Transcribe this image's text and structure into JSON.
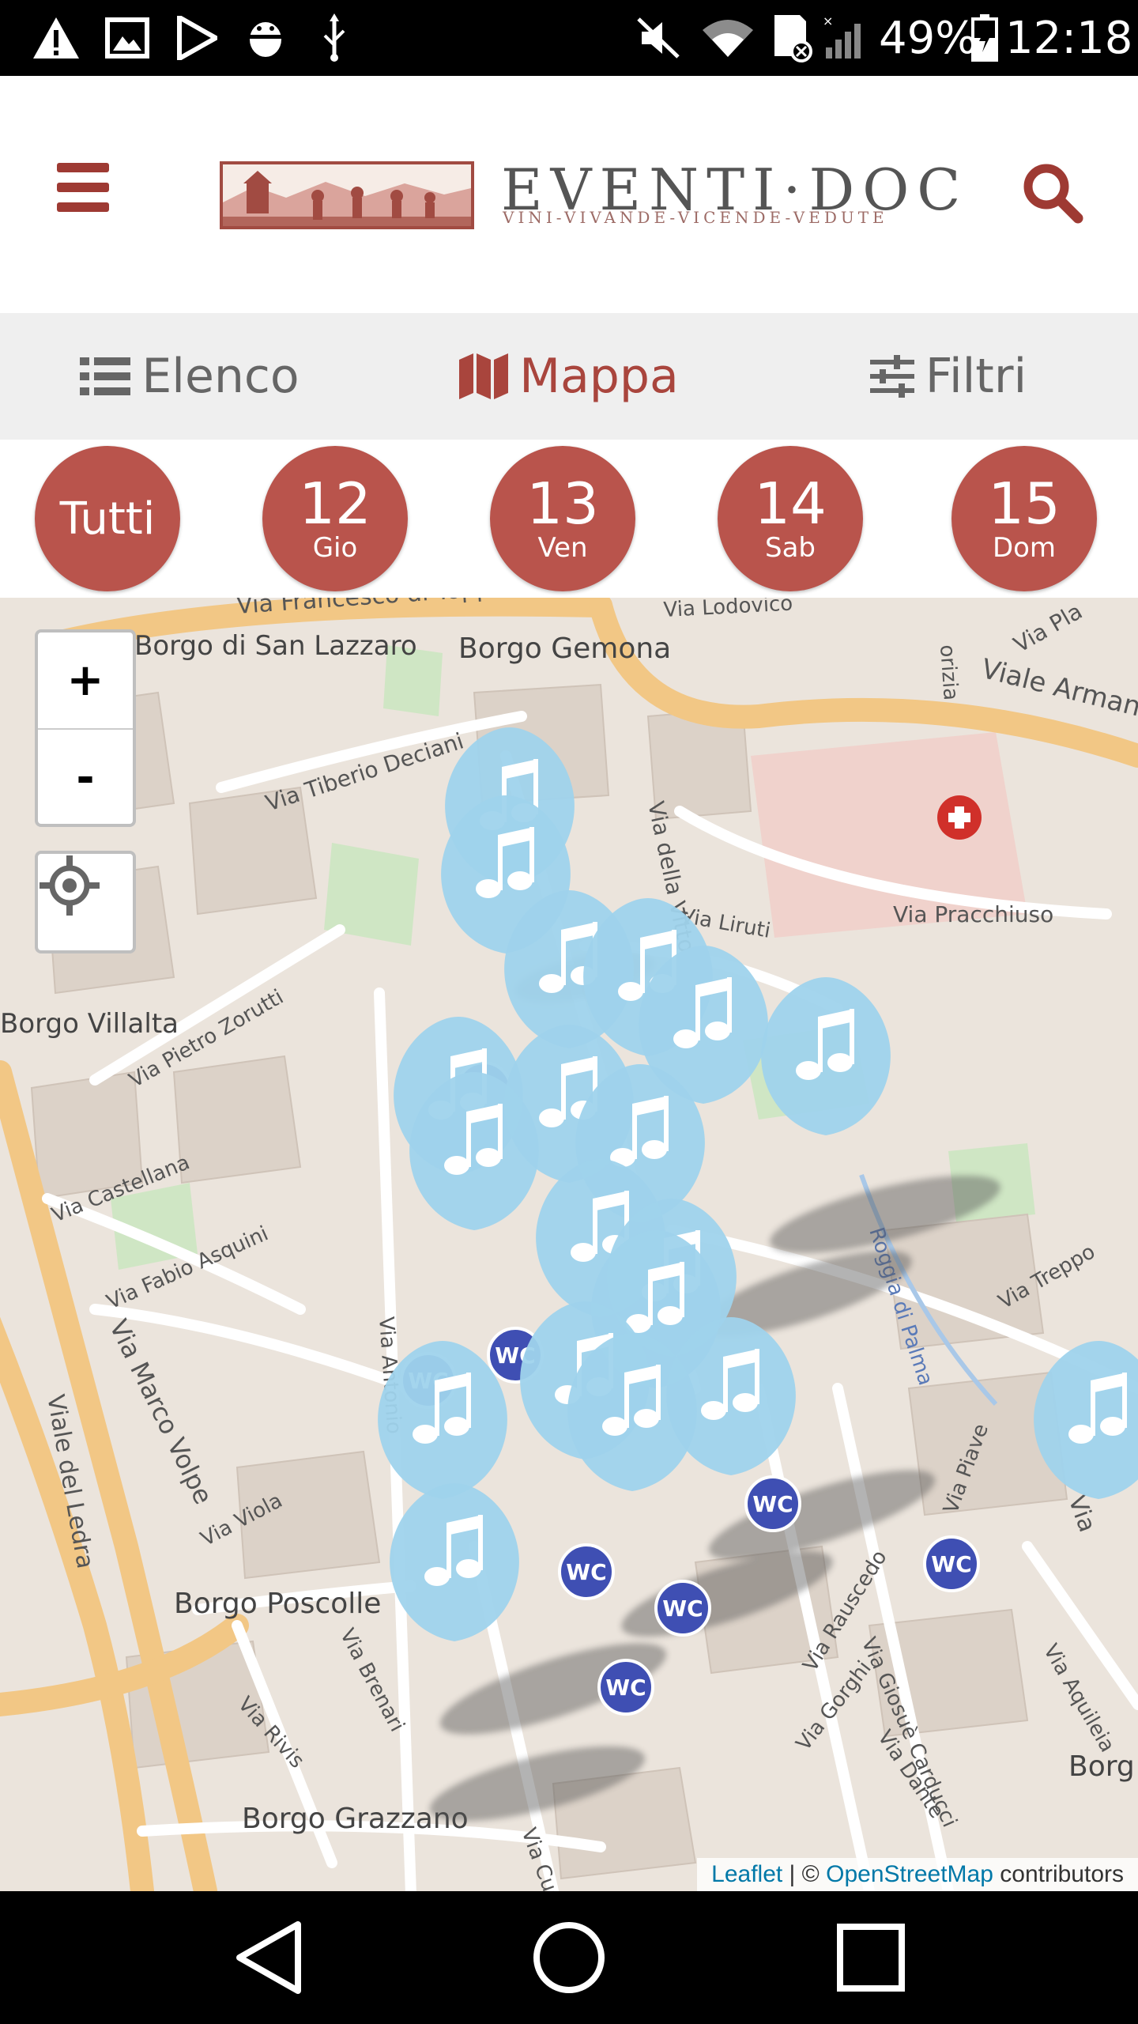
{
  "statusbar": {
    "battery": "49%",
    "time": "12:18",
    "icons": [
      "warning-icon",
      "image-icon",
      "play-store-icon",
      "android-debug-icon",
      "usb-icon",
      "mute-icon",
      "wifi-icon",
      "sd-card-icon",
      "signal-icon",
      "battery-icon"
    ]
  },
  "header": {
    "logo_title": "EVENTI·DOC",
    "logo_subtitle": "VINI-VIVANDE-VICENDE-VEDUTE"
  },
  "tabs": [
    {
      "label": "Elenco",
      "icon": "list-icon",
      "active": false
    },
    {
      "label": "Mappa",
      "icon": "map-icon",
      "active": true
    },
    {
      "label": "Filtri",
      "icon": "sliders-icon",
      "active": false
    }
  ],
  "days": [
    {
      "label": "Tutti"
    },
    {
      "num": "12",
      "dow": "Gio"
    },
    {
      "num": "13",
      "dow": "Ven"
    },
    {
      "num": "14",
      "dow": "Sab"
    },
    {
      "num": "15",
      "dow": "Dom"
    }
  ],
  "map": {
    "zoom_in": "+",
    "zoom_out": "-",
    "place_labels": [
      "Via Francesco di Toppo",
      "Via Lodovico",
      "Borgo di San Lazzaro",
      "Borgo Gemona",
      "Viale Armando Diaz",
      "Via Tiberio Deciani",
      "Via della Vittoria",
      "Via Liruti",
      "Via Pracchiuso",
      "Borgo Villalta",
      "Via Pietro Zorutti",
      "Via Castellana",
      "Via Fabio Asquini",
      "Viale del Ledra",
      "Via Marco Volpe",
      "Via Antonio",
      "Via Treppo",
      "Roggia di Palma",
      "Via Piave",
      "Via Viola",
      "Borgo Poscolle",
      "Via Brenari",
      "Via Rivis",
      "Via Rauscedo",
      "Via Gorghi",
      "Via Giosuè Carducci",
      "Via Dante",
      "Via Aquileia",
      "Borgo Grazzano",
      "Via Cussignacco",
      "Borg",
      "Via",
      "Via Pla",
      "orizia"
    ],
    "attribution": {
      "leaflet": "Leaflet",
      "sep": " | © ",
      "osm": "OpenStreetMap",
      "rest": " contributors"
    },
    "wc_label": "WC"
  },
  "colors": {
    "brand": "#a9453d",
    "day_circle": "#b9544c",
    "marker": "#9fd3ec",
    "wc": "#3f4fb3"
  }
}
